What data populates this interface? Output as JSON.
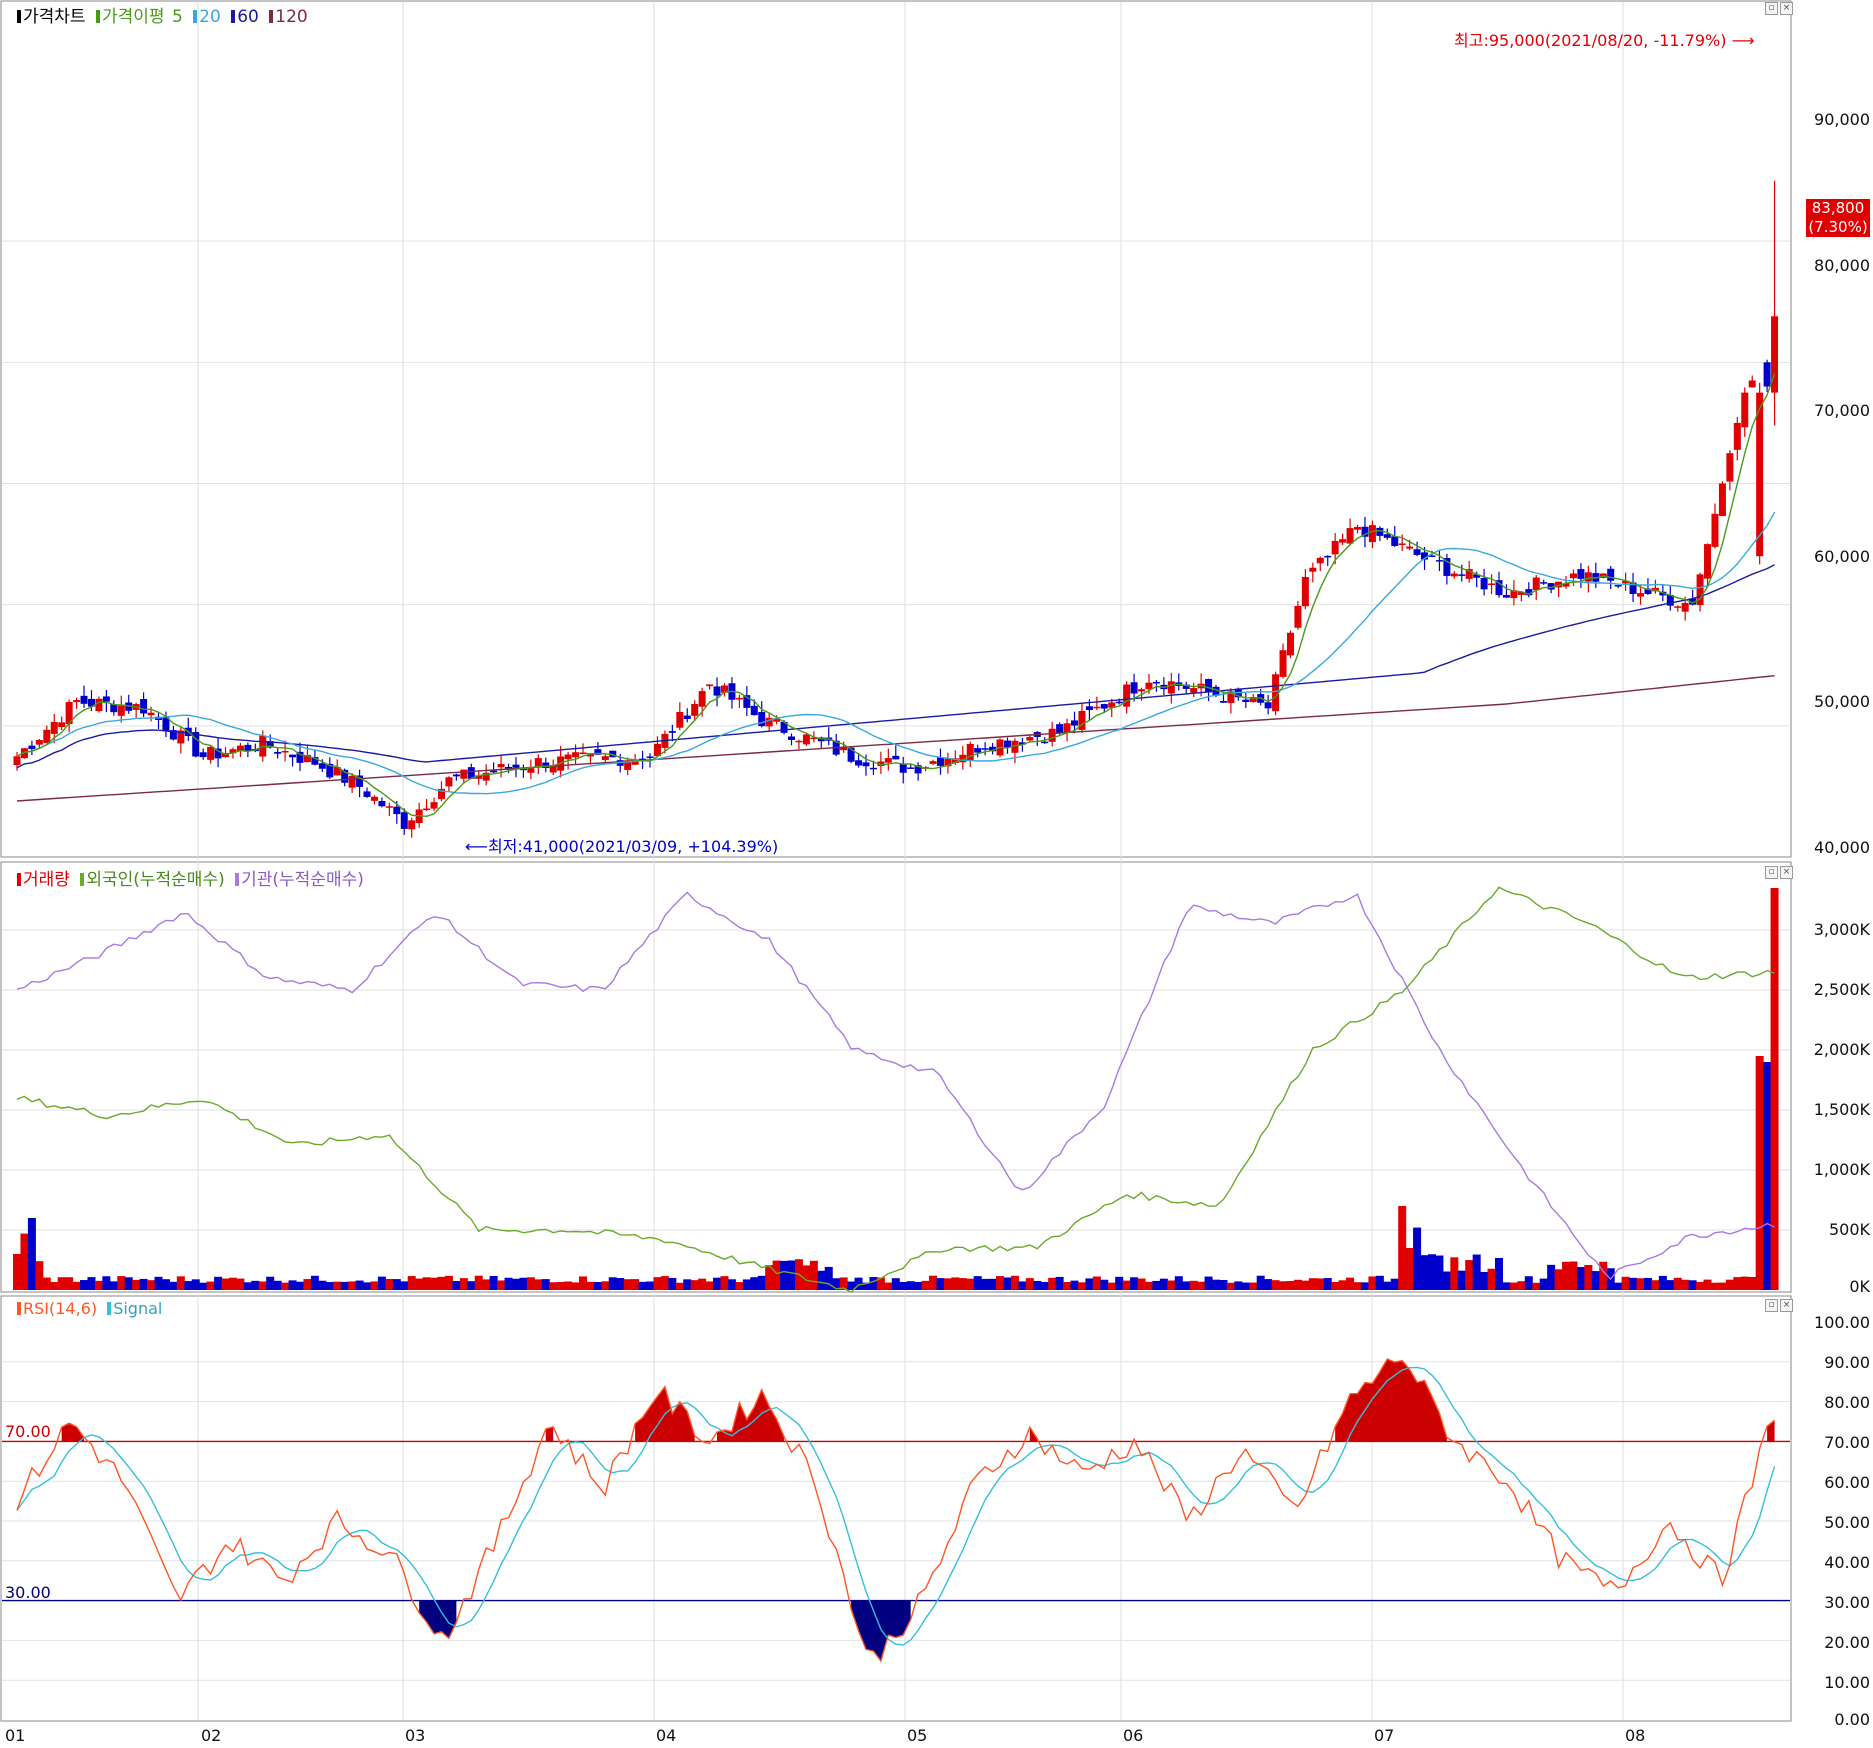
{
  "price_panel": {
    "legend": {
      "title": "가격차트",
      "ma_title": "가격이평",
      "ma5": "5",
      "ma20": "20",
      "ma60": "60",
      "ma120": "120"
    },
    "high_note": "최고:95,000(2021/08/20, -11.79%)",
    "low_note": "최저:41,000(2021/03/09, +104.39%)",
    "current_price": "83,800",
    "current_change": "(7.30%)",
    "y_ticks": [
      "90,000",
      "80,000",
      "70,000",
      "60,000",
      "50,000",
      "40,000"
    ]
  },
  "volume_panel": {
    "legend": {
      "volume": "거래량",
      "foreign": "외국인(누적순매수)",
      "institution": "기관(누적순매수)"
    },
    "y_ticks": [
      "3,000K",
      "2,500K",
      "2,000K",
      "1,500K",
      "1,000K",
      "500K",
      "0K"
    ]
  },
  "rsi_panel": {
    "legend": {
      "rsi": "RSI(14,6)",
      "signal": "Signal"
    },
    "upper_label": "70.00",
    "lower_label": "30.00",
    "y_ticks": [
      "100.00",
      "90.00",
      "80.00",
      "70.00",
      "60.00",
      "50.00",
      "40.00",
      "30.00",
      "20.00",
      "10.00",
      "0.00"
    ]
  },
  "x_ticks": [
    "01",
    "02",
    "03",
    "04",
    "05",
    "06",
    "07",
    "08"
  ],
  "colors": {
    "up": "#e00000",
    "down": "#0000cc",
    "ma5": "#4a9a1a",
    "ma20": "#3aa8e0",
    "ma60": "#1a1aa0",
    "ma120": "#7a2a4a",
    "foreign": "#6aaa2a",
    "institution": "#a87ae0",
    "rsi": "#ff5522",
    "signal": "#33c0d8"
  },
  "chart_data": [
    {
      "type": "candlestick",
      "title": "가격차트",
      "ylim": [
        40000,
        97000
      ],
      "x_labels": [
        "01",
        "02",
        "03",
        "04",
        "05",
        "06",
        "07",
        "08"
      ],
      "waypoints_close": [
        47500,
        52000,
        51500,
        47500,
        48500,
        47000,
        45000,
        42000,
        45500,
        47000,
        47500,
        53500,
        50500,
        47500,
        46500,
        48500,
        49500,
        54000,
        51500,
        62000,
        66500,
        63500,
        61000,
        62500,
        60000,
        77500,
        79500,
        83800
      ],
      "waypoint_days": [
        0,
        8,
        17,
        25,
        33,
        40,
        46,
        52,
        58,
        70,
        85,
        93,
        100,
        112,
        120,
        130,
        140,
        152,
        168,
        173,
        180,
        190,
        200,
        210,
        225,
        232,
        234,
        236
      ],
      "high": 95000,
      "low": 41000,
      "last_close": 83800
    },
    {
      "type": "bar",
      "title": "거래량",
      "series": [
        {
          "name": "거래량",
          "approx_values_k": [
            470,
            600,
            240,
            120,
            800,
            1600,
            700,
            1900,
            3350
          ]
        },
        {
          "name": "외국인(누적순매수)",
          "waypoints_k": [
            1600,
            1450,
            1600,
            1200,
            1300,
            500,
            500,
            420,
            200,
            0,
            350,
            350,
            800,
            700,
            2000,
            2500,
            3350,
            3050,
            2600,
            2650
          ]
        },
        {
          "name": "기관(누적순매수)",
          "waypoints_k": [
            2500,
            2800,
            3150,
            2600,
            2500,
            3150,
            2550,
            2500,
            3300,
            2900,
            2000,
            1800,
            800,
            1550,
            3200,
            3050,
            3300,
            2000,
            1000,
            100,
            450,
            550
          ]
        }
      ],
      "ylim": [
        0,
        3400
      ]
    },
    {
      "type": "line",
      "title": "RSI(14,6)",
      "series": [
        {
          "name": "RSI(14,6)",
          "waypoints": [
            55,
            75,
            60,
            30,
            45,
            35,
            50,
            42,
            20,
            45,
            75,
            58,
            83,
            70,
            82,
            60,
            14,
            30,
            60,
            72,
            62,
            70,
            50,
            68,
            52,
            80,
            92,
            70,
            60,
            40,
            32,
            50,
            35,
            78
          ]
        },
        {
          "name": "Signal"
        }
      ],
      "ylim": [
        0,
        100
      ],
      "bands": [
        70,
        30
      ]
    }
  ]
}
